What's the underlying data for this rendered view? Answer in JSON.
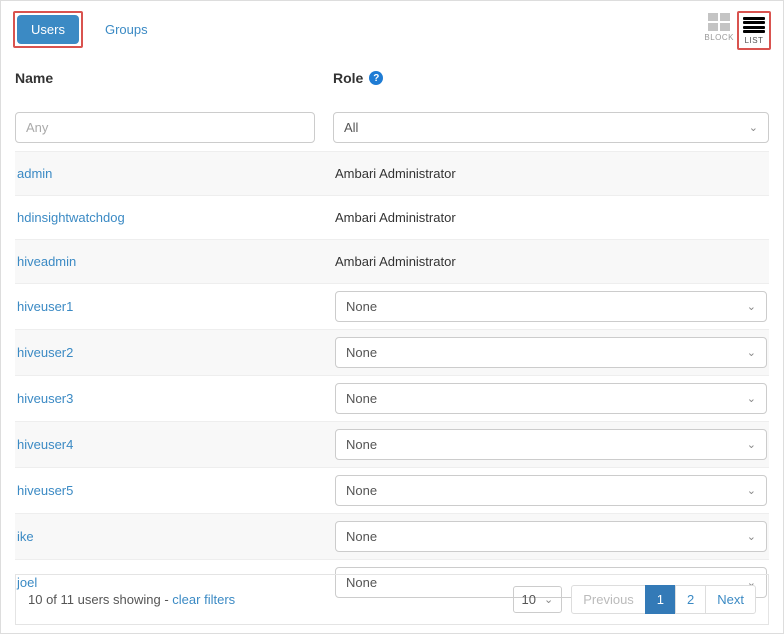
{
  "tabs": {
    "users": "Users",
    "groups": "Groups"
  },
  "view": {
    "block": "BLOCK",
    "list": "LIST"
  },
  "columns": {
    "name": "Name",
    "role": "Role"
  },
  "filters": {
    "name_placeholder": "Any",
    "role_value": "All"
  },
  "rows": [
    {
      "name": "admin",
      "role_text": "Ambari Administrator",
      "editable": false
    },
    {
      "name": "hdinsightwatchdog",
      "role_text": "Ambari Administrator",
      "editable": false
    },
    {
      "name": "hiveadmin",
      "role_text": "Ambari Administrator",
      "editable": false
    },
    {
      "name": "hiveuser1",
      "role_text": "None",
      "editable": true
    },
    {
      "name": "hiveuser2",
      "role_text": "None",
      "editable": true
    },
    {
      "name": "hiveuser3",
      "role_text": "None",
      "editable": true
    },
    {
      "name": "hiveuser4",
      "role_text": "None",
      "editable": true
    },
    {
      "name": "hiveuser5",
      "role_text": "None",
      "editable": true
    },
    {
      "name": "ike",
      "role_text": "None",
      "editable": true
    },
    {
      "name": "joel",
      "role_text": "None",
      "editable": true
    }
  ],
  "footer": {
    "status": "10 of 11 users showing - ",
    "clear": "clear filters",
    "page_size": "10",
    "prev": "Previous",
    "next": "Next",
    "pages": [
      "1",
      "2"
    ],
    "current_page": "1"
  }
}
